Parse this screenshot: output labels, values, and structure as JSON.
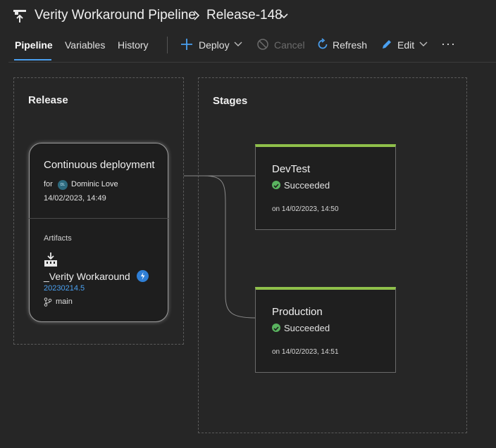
{
  "header": {
    "pipeline_title": "Verity Workaround Pipeline",
    "release_name": "Release-148",
    "icons": [
      "pipeline-logo-icon",
      "chevron-right-icon",
      "chevron-down-icon"
    ]
  },
  "toolbar": {
    "tabs": [
      {
        "label": "Pipeline",
        "active": true
      },
      {
        "label": "Variables",
        "active": false
      },
      {
        "label": "History",
        "active": false
      }
    ],
    "deploy_label": "Deploy",
    "cancel_label": "Cancel",
    "refresh_label": "Refresh",
    "edit_label": "Edit",
    "more_label": "···"
  },
  "release_panel": {
    "title": "Release",
    "card": {
      "trigger": "Continuous deployment",
      "for_label": "for",
      "avatar_initials": "DL",
      "user": "Dominic Love",
      "timestamp": "14/02/2023, 14:49",
      "artifacts_label": "Artifacts",
      "artifact_name": "_Verity Workaround",
      "artifact_version": "20230214.5",
      "branch": "main"
    }
  },
  "stages_panel": {
    "title": "Stages",
    "stages": [
      {
        "name": "DevTest",
        "status": "Succeeded",
        "time": "on 14/02/2023, 14:50"
      },
      {
        "name": "Production",
        "status": "Succeeded",
        "time": "on 14/02/2023, 14:51"
      }
    ]
  },
  "colors": {
    "background": "#262626",
    "accent": "#4aa0f0",
    "success": "#59b35f",
    "stage_bar": "#8fc04a",
    "link": "#4aa0f0"
  }
}
